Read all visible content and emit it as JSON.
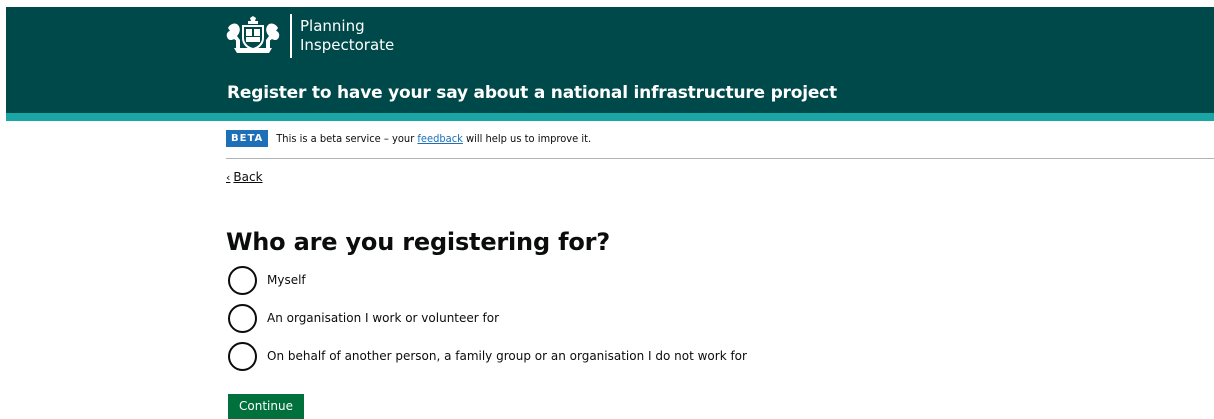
{
  "header": {
    "logo_line1": "Planning",
    "logo_line2": "Inspectorate",
    "service_name": "Register to have your say about a national infrastructure project",
    "background_color": "#00494a",
    "stripe_color": "#1ba6a6"
  },
  "phase_banner": {
    "tag": "BETA",
    "text_before": "This is a beta service – your ",
    "link_text": "feedback",
    "text_after": " will help us to improve it.",
    "tag_color": "#1d70b8"
  },
  "back_link": {
    "chevron": "‹",
    "label": "Back"
  },
  "question": {
    "title": "Who are you registering for?",
    "options": [
      {
        "label": "Myself",
        "selected": false
      },
      {
        "label": "An organisation I work or volunteer for",
        "selected": false
      },
      {
        "label": "On behalf of another person, a family group or an organisation I do not work for",
        "selected": false
      }
    ]
  },
  "continue_button": {
    "label": "Continue",
    "color": "#00703c"
  }
}
